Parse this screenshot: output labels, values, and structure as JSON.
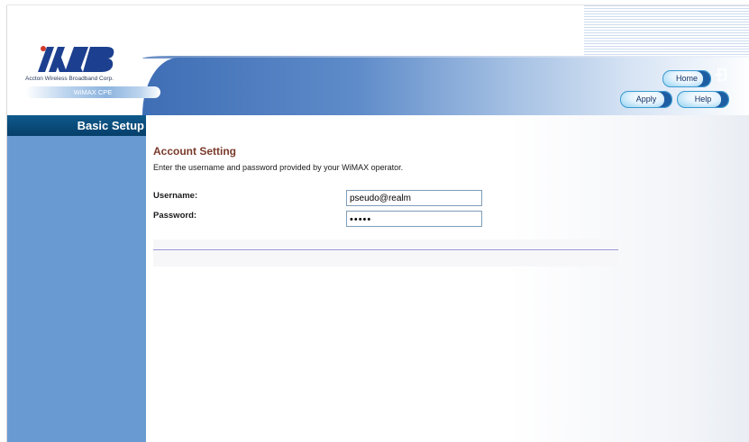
{
  "brand": {
    "company": "Accton Wireless Broadband Corp.",
    "product": "WiMAX CPE",
    "logo_text": "AWB",
    "colors": {
      "navy": "#1d3f8f",
      "accent_red": "#d23a2a",
      "sidebar_blue": "#6a9ad2"
    }
  },
  "header": {
    "home_label": "Home",
    "apply_label": "Apply",
    "help_label": "Help",
    "logout_icon": "logout-icon"
  },
  "sidebar": {
    "title": "Basic Setup"
  },
  "main": {
    "section_title": "Account Setting",
    "description": "Enter the username and password provided by your WiMAX operator.",
    "username": {
      "label": "Username:",
      "value": "pseudo@realm"
    },
    "password": {
      "label": "Password:",
      "value": "•••••"
    }
  }
}
